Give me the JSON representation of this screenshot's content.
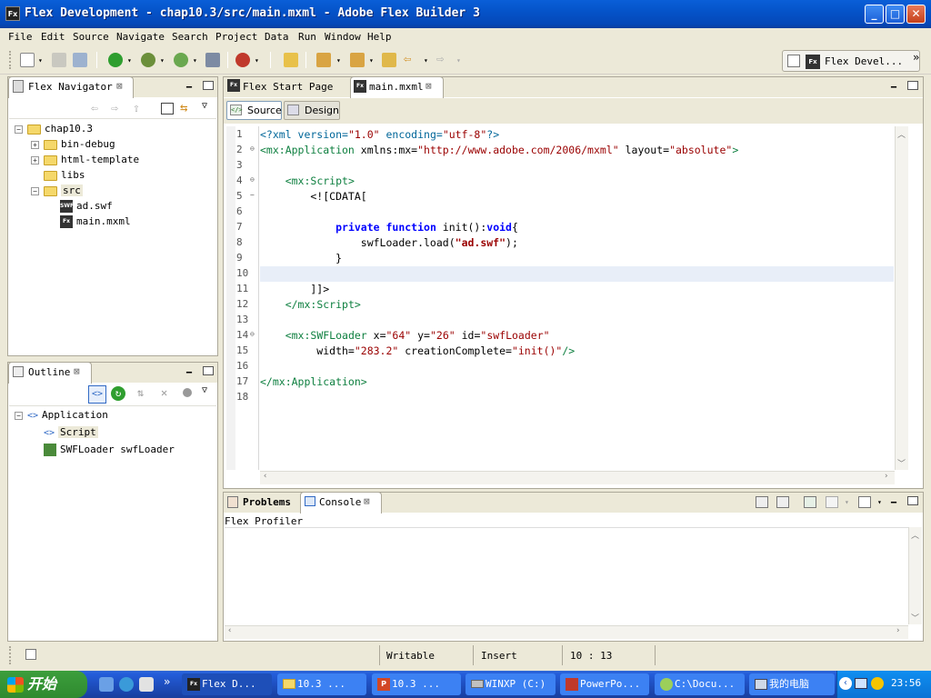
{
  "window": {
    "title": "Flex Development - chap10.3/src/main.mxml - Adobe Flex Builder 3",
    "app_icon": "Fx"
  },
  "menu": [
    "File",
    "Edit",
    "Source",
    "Navigate",
    "Search",
    "Project",
    "Data",
    "Run",
    "Window",
    "Help"
  ],
  "toolbar": {
    "perspective_label": "Flex Devel..."
  },
  "navigator": {
    "title": "Flex Navigator",
    "tree": [
      {
        "label": "chap10.3",
        "level": 0,
        "expander": "−",
        "icon": "project-folder-icon"
      },
      {
        "label": "bin-debug",
        "level": 1,
        "expander": "+",
        "icon": "folder-icon"
      },
      {
        "label": "html-template",
        "level": 1,
        "expander": "+",
        "icon": "folder-icon"
      },
      {
        "label": "libs",
        "level": 1,
        "expander": "",
        "icon": "folder-icon"
      },
      {
        "label": "src",
        "level": 1,
        "expander": "−",
        "icon": "package-folder-icon"
      },
      {
        "label": "ad.swf",
        "level": 2,
        "expander": "",
        "icon": "swf-file-icon"
      },
      {
        "label": "main.mxml",
        "level": 2,
        "expander": "",
        "icon": "mxml-file-icon"
      }
    ]
  },
  "outline": {
    "title": "Outline",
    "tree": [
      {
        "label": "Application",
        "level": 0,
        "expander": "−",
        "icon": "tag-icon"
      },
      {
        "label": "Script",
        "level": 1,
        "expander": "",
        "icon": "tag-icon"
      },
      {
        "label": "SWFLoader swfLoader",
        "level": 1,
        "expander": "",
        "icon": "swfloader-icon"
      }
    ]
  },
  "editor": {
    "tabs": [
      {
        "label": "Flex Start Page",
        "active": false
      },
      {
        "label": "main.mxml",
        "active": true
      }
    ],
    "modes": {
      "source": "Source",
      "design": "Design"
    },
    "line_numbers": [
      "1",
      "2",
      "3",
      "4",
      "5",
      "6",
      "7",
      "8",
      "9",
      "10",
      "11",
      "12",
      "13",
      "14",
      "15",
      "16",
      "17",
      "18"
    ]
  },
  "bottom": {
    "tabs": [
      {
        "label": "Problems"
      },
      {
        "label": "Console"
      }
    ],
    "console_title": "Flex Profiler"
  },
  "status": {
    "writable": "Writable",
    "insert": "Insert",
    "position": "10 : 13"
  },
  "taskbar": {
    "start": "开始",
    "tasks": [
      "Flex D...",
      "10.3 ...",
      "10.3 ...",
      "WINXP (C:)",
      "PowerPo...",
      "C:\\Docu...",
      "我的电脑"
    ],
    "clock": "23:56"
  }
}
